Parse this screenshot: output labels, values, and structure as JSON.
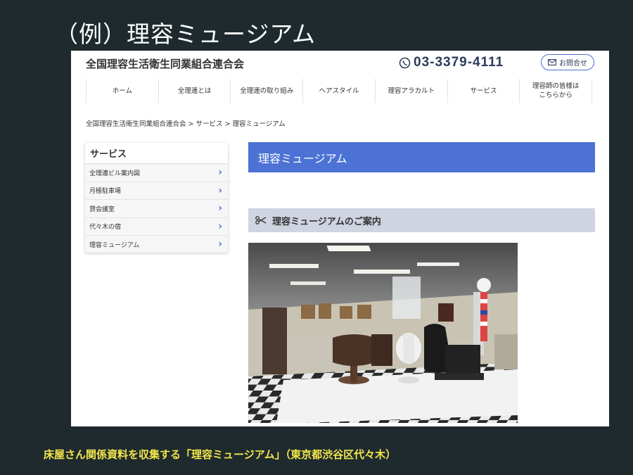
{
  "slide": {
    "title": "（例）理容ミュージアム",
    "caption": "床屋さん関係資料を収集する「理容ミュージアム」（東京都渋谷区代々木）"
  },
  "header": {
    "org_name": "全国理容生活衛生同業組合連合会",
    "phone": "03-3379-4111",
    "contact_label": "お問合せ"
  },
  "nav": {
    "items": [
      {
        "label": "ホーム"
      },
      {
        "label": "全理連とは"
      },
      {
        "label": "全理連の取り組み"
      },
      {
        "label": "ヘアスタイル"
      },
      {
        "label": "理容アラカルト"
      },
      {
        "label": "サービス"
      },
      {
        "label": "理容師の皆様は\nこちらから"
      }
    ]
  },
  "breadcrumb": "全国理容生活衛生同業組合連合会 > サービス > 理容ミュージアム",
  "sidebar": {
    "heading": "サービス",
    "items": [
      {
        "label": "全理連ビル案内図"
      },
      {
        "label": "月極駐車場"
      },
      {
        "label": "貸会議室"
      },
      {
        "label": "代々木の宿"
      },
      {
        "label": "理容ミュージアム"
      }
    ]
  },
  "main": {
    "page_title": "理容ミュージアム",
    "section_title": "理容ミュージアムのご案内"
  },
  "colors": {
    "accent": "#4b72d4",
    "slide_bg": "#1e2a2e",
    "caption": "#f2e64a"
  }
}
